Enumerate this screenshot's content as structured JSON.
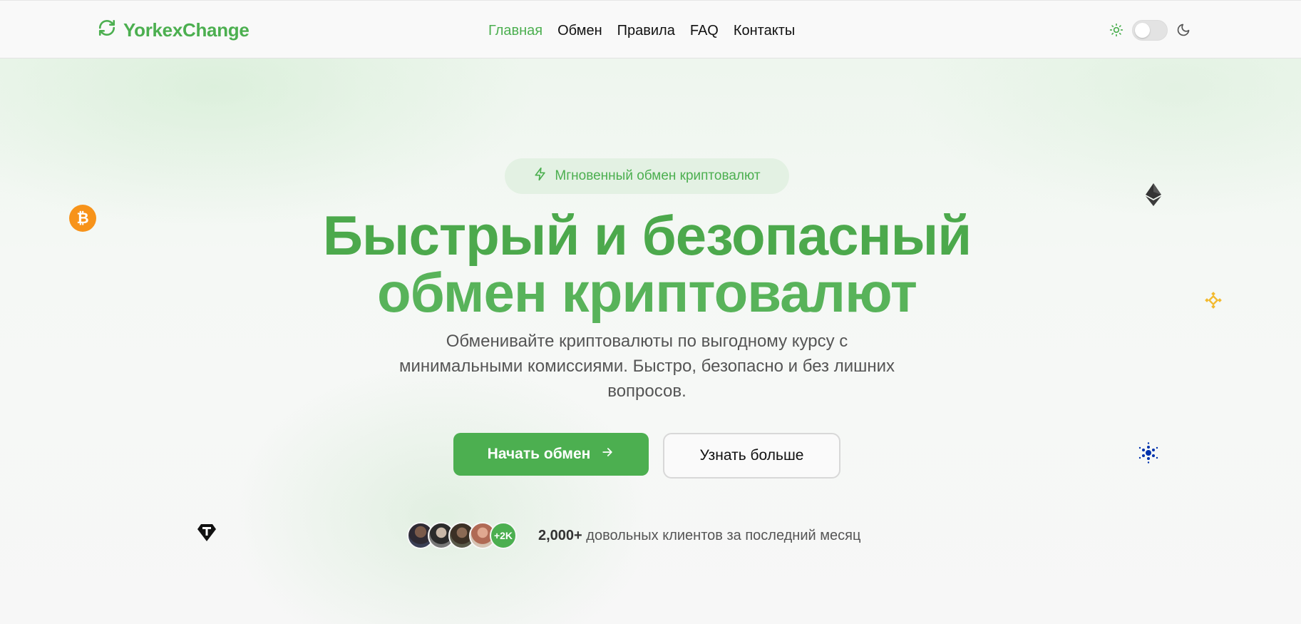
{
  "header": {
    "brand": "YorkexChange",
    "nav": [
      {
        "label": "Главная",
        "active": true
      },
      {
        "label": "Обмен",
        "active": false
      },
      {
        "label": "Правила",
        "active": false
      },
      {
        "label": "FAQ",
        "active": false
      },
      {
        "label": "Контакты",
        "active": false
      }
    ],
    "theme_toggle": {
      "state": "light"
    }
  },
  "hero": {
    "badge": "Мгновенный обмен криптовалют",
    "title_line1": "Быстрый и безопасный",
    "title_line2": "обмен криптовалют",
    "subtitle": "Обменивайте криптовалюты по выгодному курсу с минимальными комиссиями. Быстро, безопасно и без лишних вопросов.",
    "primary_button": "Начать обмен",
    "secondary_button": "Узнать больше",
    "clients": {
      "more_badge": "+2K",
      "count": "2,000+",
      "text": "довольных клиентов за последний месяц"
    }
  },
  "floating_icons": [
    "bitcoin-icon",
    "ethereum-icon",
    "binance-icon",
    "cardano-icon",
    "tether-icon"
  ],
  "colors": {
    "accent": "#4caf50",
    "title": "#4ca94c",
    "bitcoin": "#f7931a",
    "binance": "#f3ba2f",
    "cardano": "#0033ad"
  }
}
